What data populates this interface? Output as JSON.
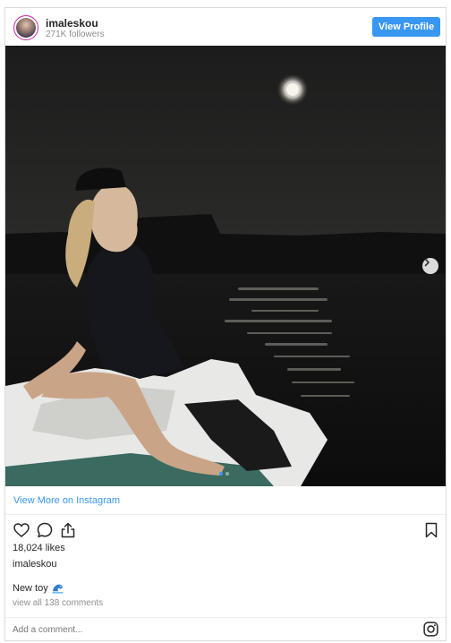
{
  "header": {
    "username": "imaleskou",
    "followers": "271K followers",
    "view_profile_label": "View Profile"
  },
  "photo": {
    "carousel_position": 1,
    "carousel_count": 2
  },
  "view_more_label": "View More on Instagram",
  "actions": {
    "icons": [
      "heart-icon",
      "comment-icon",
      "share-icon",
      "bookmark-icon"
    ]
  },
  "likes": "18,024 likes",
  "caption_username": "imaleskou",
  "caption_text": "New toy",
  "caption_emoji_icon": "wave-icon",
  "comments_link": "view all 138 comments",
  "comment_placeholder": "Add a comment...",
  "colors": {
    "accent": "#3897f0",
    "border": "#dbdbdb",
    "muted_text": "#8e8e8e"
  }
}
